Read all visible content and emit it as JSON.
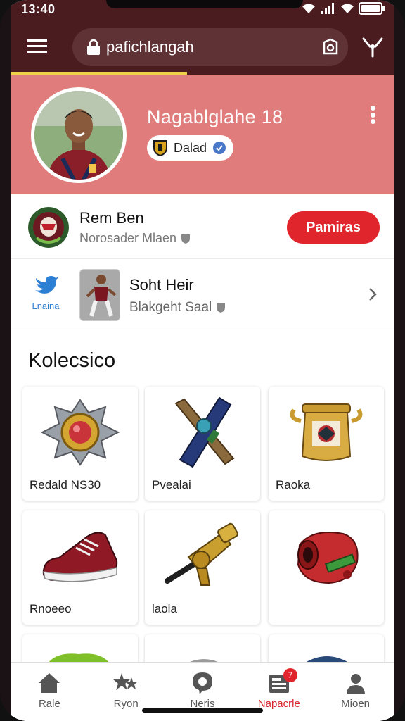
{
  "status_bar": {
    "time": "13:40"
  },
  "browser": {
    "url": "pafichlangah",
    "icons": [
      "menu-icon",
      "lock-icon",
      "tab-icon",
      "extension-icon"
    ]
  },
  "profile": {
    "name": "Nagablglahe 18",
    "badge_label": "Dalad"
  },
  "club_row": {
    "title": "Rem Ben",
    "subtitle": "Norosader Mlaen",
    "action_label": "Pamiras"
  },
  "player_row": {
    "brand_label": "Lnaina",
    "title": "Soht Heir",
    "subtitle": "Blakgeht Saal"
  },
  "collection": {
    "title": "Kolecsico",
    "items": [
      {
        "label": "Redald NS30",
        "icon": "shield-medal-icon"
      },
      {
        "label": "Pvealai",
        "icon": "crossed-bats-icon"
      },
      {
        "label": "Raoka",
        "icon": "trophy-pot-icon"
      },
      {
        "label": "Rnoeeo",
        "icon": "sneaker-icon"
      },
      {
        "label": "laola",
        "icon": "golden-cannon-icon"
      },
      {
        "label": "",
        "icon": "red-drum-icon"
      }
    ]
  },
  "bottom_nav": {
    "items": [
      {
        "label": "Rale",
        "icon": "home-icon"
      },
      {
        "label": "Ryon",
        "icon": "stars-icon"
      },
      {
        "label": "Neris",
        "icon": "chat-bubble-icon"
      },
      {
        "label": "Napacrle",
        "icon": "news-icon",
        "badge": "7",
        "active": true
      },
      {
        "label": "Mioen",
        "icon": "person-icon"
      }
    ]
  },
  "colors": {
    "header": "#e07c7c",
    "browser_bar": "#4a1c20",
    "accent": "#e0262c"
  }
}
